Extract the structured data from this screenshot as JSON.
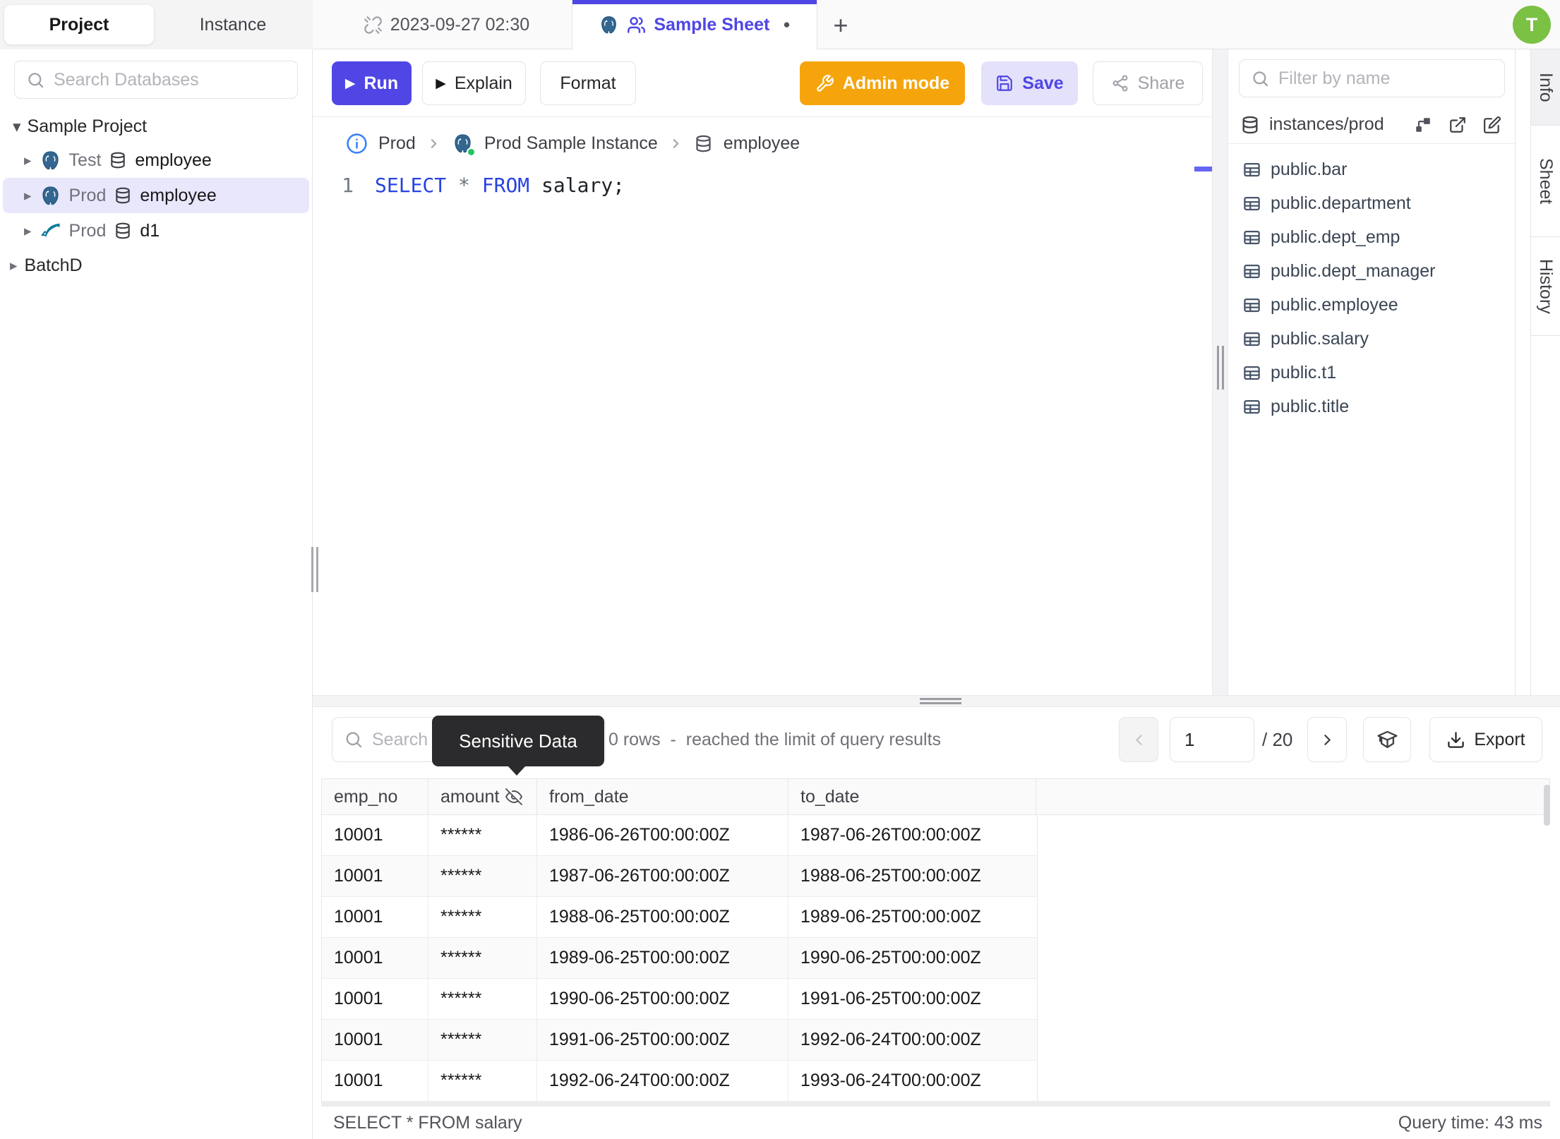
{
  "icons": {
    "caret_down": "▾",
    "caret_right": "▸",
    "dirty_dot": "●",
    "plus": "+",
    "play": "▶"
  },
  "left_sidebar": {
    "tabs": [
      {
        "label": "Project"
      },
      {
        "label": "Instance"
      }
    ],
    "search_placeholder": "Search Databases",
    "project_group": "Sample Project",
    "tree_items": [
      {
        "env": "Test",
        "db": "employee",
        "engine": "postgres"
      },
      {
        "env": "Prod",
        "db": "employee",
        "engine": "postgres"
      },
      {
        "env": "Prod",
        "db": "d1",
        "engine": "mysql"
      }
    ],
    "batch_group": "BatchD"
  },
  "tab_bar": {
    "history_tab": "2023-09-27 02:30",
    "sheet_tab": "Sample Sheet",
    "avatar_initial": "T"
  },
  "toolbar": {
    "run": "Run",
    "explain": "Explain",
    "format": "Format",
    "admin_mode": "Admin mode",
    "save": "Save",
    "share": "Share"
  },
  "breadcrumb": {
    "environment": "Prod",
    "instance": "Prod Sample Instance",
    "database": "employee"
  },
  "editor": {
    "line_no": "1",
    "kw_select": "SELECT",
    "star": "*",
    "kw_from": "FROM",
    "rest": "salary;"
  },
  "right_sidebar": {
    "filter_placeholder": "Filter by name",
    "connection": "instances/prod",
    "tables": [
      "public.bar",
      "public.department",
      "public.dept_emp",
      "public.dept_manager",
      "public.employee",
      "public.salary",
      "public.t1",
      "public.title"
    ]
  },
  "side_tabs": {
    "info": "Info",
    "sheet": "Sheet",
    "history": "History"
  },
  "results": {
    "search_placeholder": "Search",
    "tooltip": "Sensitive Data",
    "summary": "0 rows  -  reached the limit of query results",
    "page": "1",
    "page_total": "/ 20",
    "export_label": "Export",
    "columns": [
      "emp_no",
      "amount",
      "from_date",
      "to_date"
    ],
    "rows": [
      [
        "10001",
        "******",
        "1986-06-26T00:00:00Z",
        "1987-06-26T00:00:00Z"
      ],
      [
        "10001",
        "******",
        "1987-06-26T00:00:00Z",
        "1988-06-25T00:00:00Z"
      ],
      [
        "10001",
        "******",
        "1988-06-25T00:00:00Z",
        "1989-06-25T00:00:00Z"
      ],
      [
        "10001",
        "******",
        "1989-06-25T00:00:00Z",
        "1990-06-25T00:00:00Z"
      ],
      [
        "10001",
        "******",
        "1990-06-25T00:00:00Z",
        "1991-06-25T00:00:00Z"
      ],
      [
        "10001",
        "******",
        "1991-06-25T00:00:00Z",
        "1992-06-24T00:00:00Z"
      ],
      [
        "10001",
        "******",
        "1992-06-24T00:00:00Z",
        "1993-06-24T00:00:00Z"
      ]
    ],
    "status_query": "SELECT * FROM salary",
    "status_time": "Query time: 43 ms"
  },
  "colors": {
    "accent": "#4f46e5",
    "admin_orange": "#f5a50b",
    "avatar_green": "#7bc143",
    "keyword_blue": "#2743e0",
    "status_green": "#22c55e",
    "tooltip_bg": "#2b2b2d"
  }
}
